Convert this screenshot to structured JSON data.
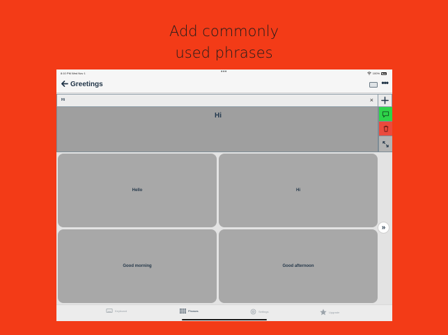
{
  "headline": {
    "line1": "Add commonly",
    "line2": "used phrases"
  },
  "status_bar": {
    "time": "8:10 PM  Wed Nov 1",
    "dots": "•••",
    "battery": "100%"
  },
  "nav": {
    "back_icon": "arrow-left-icon",
    "title": "Greetings"
  },
  "input": {
    "value": "Hi",
    "clear_symbol": "×"
  },
  "display": {
    "text": "Hi"
  },
  "colors": {
    "background": "#f33b17",
    "speak": "#2ed44a",
    "delete": "#ea4a3d",
    "text_dark": "#1f3346"
  },
  "phrases": [
    "Hello",
    "Hi",
    "Good morning",
    "Good afternoon"
  ],
  "next_page_symbol": "»",
  "tabs": [
    {
      "label": "Keyboard",
      "icon": "keyboard-icon"
    },
    {
      "label": "Phrases",
      "icon": "grid-icon"
    },
    {
      "label": "Settings",
      "icon": "gear-icon"
    },
    {
      "label": "Upgrade",
      "icon": "star-icon"
    }
  ]
}
